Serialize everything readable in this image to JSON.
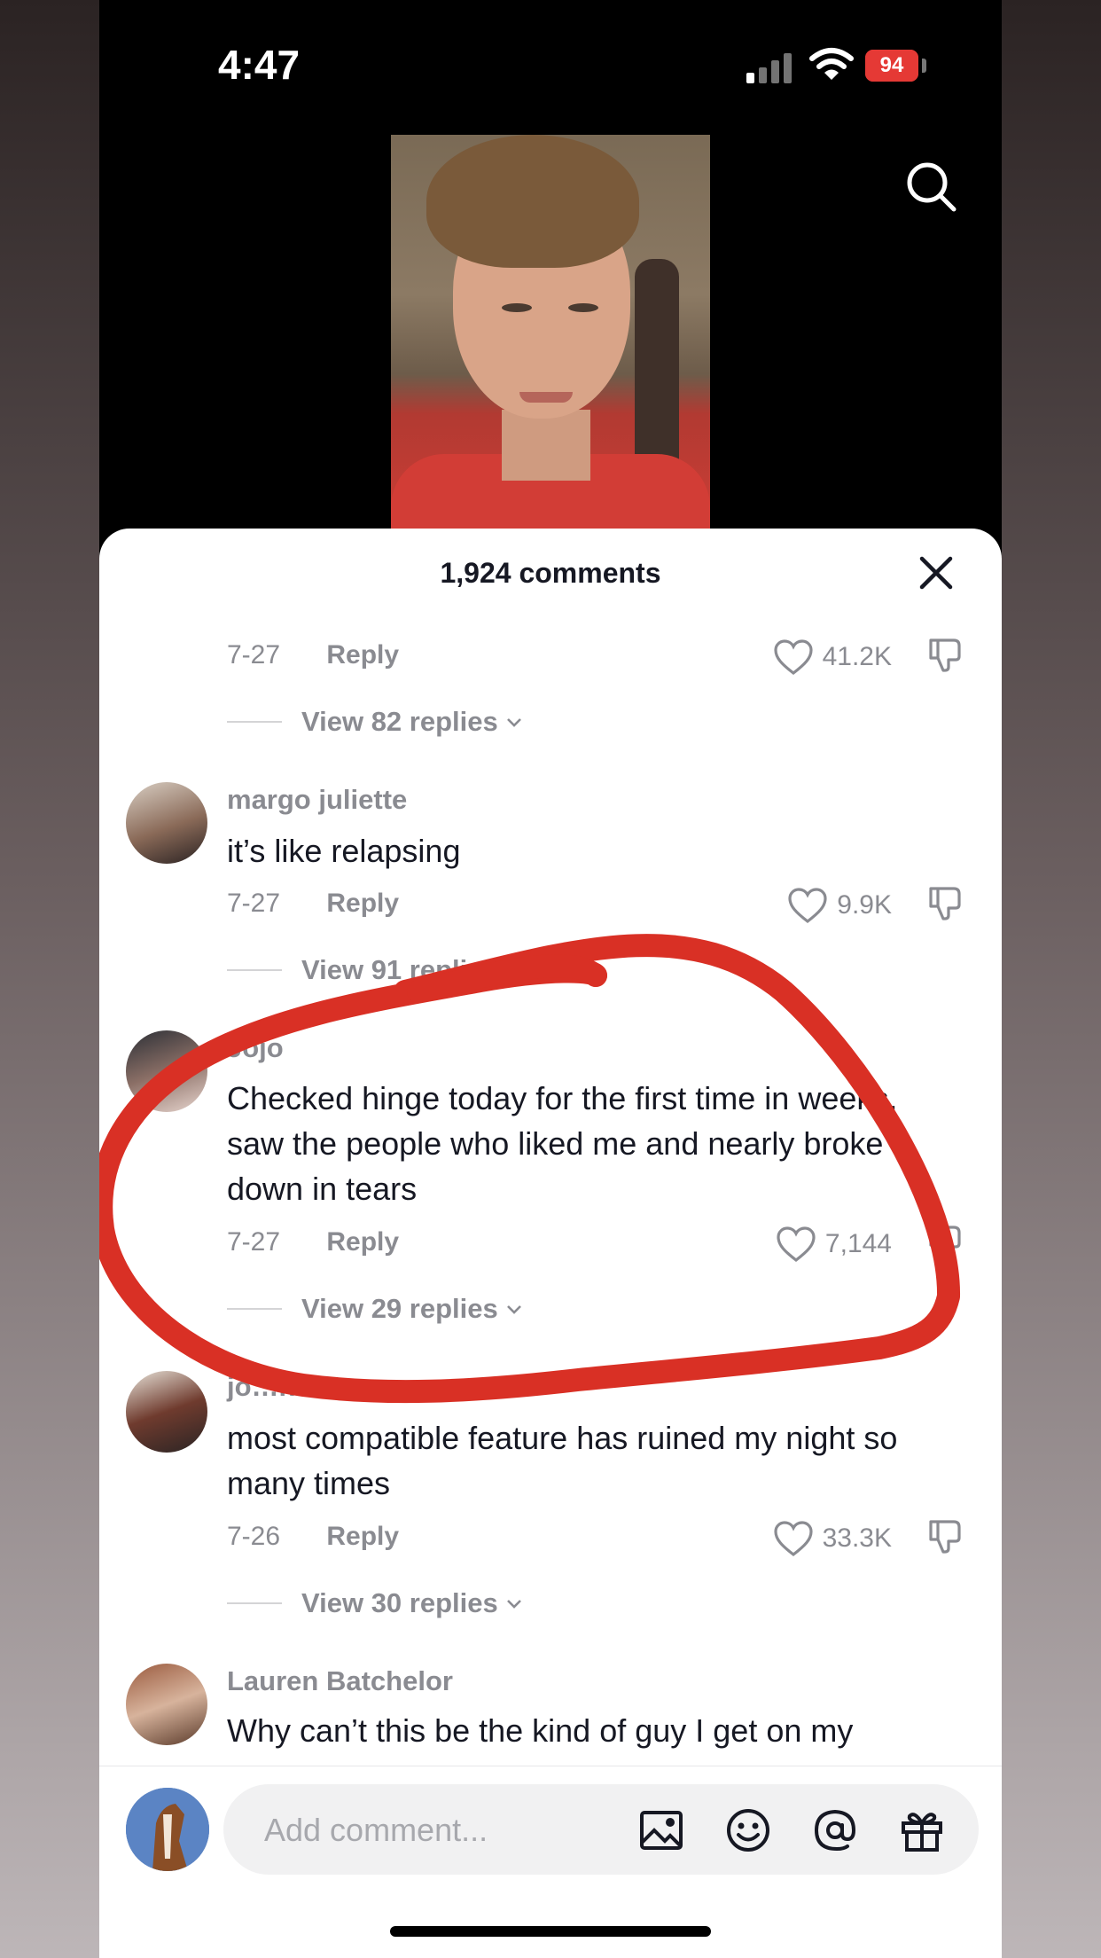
{
  "status_bar": {
    "time": "4:47",
    "battery": "94"
  },
  "sheet": {
    "title": "1,924 comments"
  },
  "comments": [
    {
      "date": "7-27",
      "reply_label": "Reply",
      "likes": "41.2K",
      "view_replies": "View 82 replies"
    },
    {
      "username": "margo juliette",
      "text": "it’s like relapsing",
      "date": "7-27",
      "reply_label": "Reply",
      "likes": "9.9K",
      "view_replies": "View 91 replies"
    },
    {
      "username": "Jojo",
      "text": "Checked hinge today for the first time in weeks, saw the people who liked me and nearly broke down in tears",
      "date": "7-27",
      "reply_label": "Reply",
      "likes": "7,144",
      "view_replies": "View 29 replies"
    },
    {
      "username": "jo…nicko",
      "text": "most compatible feature has ruined my night so many times",
      "date": "7-26",
      "reply_label": "Reply",
      "likes": "33.3K",
      "view_replies": "View 30 replies"
    },
    {
      "username": "Lauren Batchelor",
      "text": "Why can’t this be the kind of guy I get on my"
    }
  ],
  "composer": {
    "placeholder": "Add comment..."
  },
  "colors": {
    "annotation": "#d93025",
    "muted_text": "#8a8b91",
    "text": "#161823"
  },
  "icons": [
    "search-icon",
    "close-icon",
    "heart-icon",
    "dislike-icon",
    "chevron-down-icon",
    "image-icon",
    "emoji-icon",
    "mention-icon",
    "gift-icon"
  ]
}
